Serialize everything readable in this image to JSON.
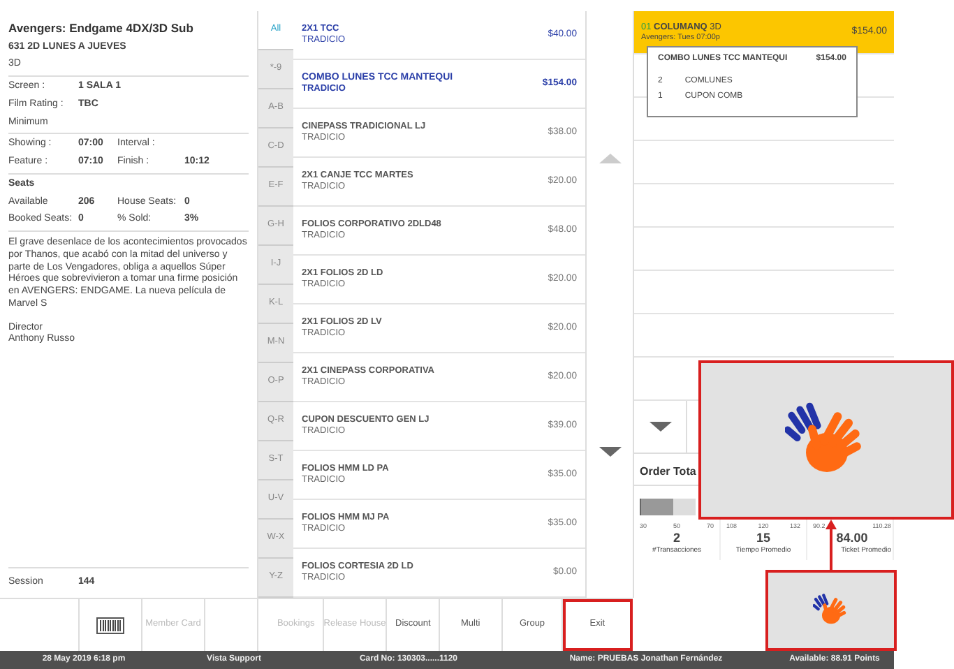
{
  "film": {
    "title": "Avengers: Endgame 4DX/3D Sub",
    "subtitle": "631 2D LUNES A JUEVES",
    "format": "3D",
    "details": [
      [
        "Screen :",
        "1  SALA 1"
      ],
      [
        "Film Rating :",
        "TBC"
      ]
    ],
    "rating_note": "Minimum",
    "times": [
      [
        "Showing :",
        "07:00",
        "Interval :"
      ],
      [
        "Feature :",
        "07:10",
        "Finish :",
        "10:12"
      ]
    ],
    "seats": {
      "heading": "Seats",
      "rows": [
        [
          "Available",
          "206",
          "House Seats:",
          "0"
        ],
        [
          "Booked Seats:",
          "0",
          "% Sold:",
          "3%"
        ]
      ]
    },
    "synopsis": "El grave desenlace de los acontecimientos provocados por Thanos, que acabó con la mitad del universo y parte de Los Vengadores, obliga a aquellos Súper Héroes que sobrevivieron a tomar una firme posición en AVENGERS: ENDGAME. La nueva película de Marvel S",
    "director": {
      "label": "Director",
      "name": "Anthony Russo"
    },
    "session": {
      "label": "Session",
      "value": "144"
    }
  },
  "alpha_tabs": [
    {
      "label": "All",
      "selected": true
    },
    {
      "label": "*-9",
      "selected": false
    },
    {
      "label": "A-B",
      "selected": false
    },
    {
      "label": "C-D",
      "selected": false
    },
    {
      "label": "E-F",
      "selected": false
    },
    {
      "label": "G-H",
      "selected": false
    },
    {
      "label": "I-J",
      "selected": false
    },
    {
      "label": "K-L",
      "selected": false
    },
    {
      "label": "M-N",
      "selected": false
    },
    {
      "label": "O-P",
      "selected": false
    },
    {
      "label": "Q-R",
      "selected": false
    },
    {
      "label": "S-T",
      "selected": false
    },
    {
      "label": "U-V",
      "selected": false
    },
    {
      "label": "W-X",
      "selected": false
    },
    {
      "label": "Y-Z",
      "selected": false
    }
  ],
  "items": [
    {
      "name": "2X1 TCC",
      "category": "TRADICIO",
      "price": "$40.00",
      "highlighted": true,
      "selected": false
    },
    {
      "name": "COMBO LUNES TCC MANTEQUI",
      "category": "TRADICIO",
      "price": "$154.00",
      "highlighted": true,
      "selected": true
    },
    {
      "name": "CINEPASS TRADICIONAL LJ",
      "category": "TRADICIO",
      "price": "$38.00",
      "highlighted": false,
      "selected": false
    },
    {
      "name": "2X1 CANJE TCC MARTES",
      "category": "TRADICIO",
      "price": "$20.00",
      "highlighted": false,
      "selected": false
    },
    {
      "name": "FOLIOS CORPORATIVO 2DLD48",
      "category": "TRADICIO",
      "price": "$48.00",
      "highlighted": false,
      "selected": false
    },
    {
      "name": "2X1 FOLIOS 2D LD",
      "category": "TRADICIO",
      "price": "$20.00",
      "highlighted": false,
      "selected": false
    },
    {
      "name": "2X1 FOLIOS 2D LV",
      "category": "TRADICIO",
      "price": "$20.00",
      "highlighted": false,
      "selected": false
    },
    {
      "name": "2X1 CINEPASS CORPORATIVA",
      "category": "TRADICIO",
      "price": "$20.00",
      "highlighted": false,
      "selected": false
    },
    {
      "name": "CUPON DESCUENTO GEN LJ",
      "category": "TRADICIO",
      "price": "$39.00",
      "highlighted": false,
      "selected": false
    },
    {
      "name": "FOLIOS HMM LD PA",
      "category": "TRADICIO",
      "price": "$35.00",
      "highlighted": false,
      "selected": false
    },
    {
      "name": "FOLIOS HMM MJ PA",
      "category": "TRADICIO",
      "price": "$35.00",
      "highlighted": false,
      "selected": false
    },
    {
      "name": "FOLIOS CORTESIA 2D LD",
      "category": "TRADICIO",
      "price": "$0.00",
      "highlighted": false,
      "selected": false
    }
  ],
  "order": {
    "lines": [
      {
        "number": "01",
        "title": "**COLUMANQ** 3D",
        "subtitle": "Avengers: Tues 07:00p",
        "price": "$154.00",
        "selected": true
      }
    ],
    "popup": {
      "title": "COMBO LUNES TCC MANTEQUI",
      "price": "$154.00",
      "components": [
        [
          "2",
          "COMLUNES"
        ],
        [
          "1",
          "CUPON COMB"
        ]
      ]
    },
    "total_label": "Order Tota",
    "gauges": [
      {
        "ticks": [
          "30",
          "50",
          "70"
        ],
        "value": "2",
        "label": "#Transacciones",
        "level": 0.6
      },
      {
        "ticks": [
          "108",
          "120",
          "132"
        ],
        "value": "15",
        "label": "Tiempo Promedio"
      },
      {
        "ticks": [
          "90.2",
          "110.28"
        ],
        "value": "84.00",
        "label": "Ticket Promedio"
      }
    ]
  },
  "left_buttons": [
    {
      "kind": "blank"
    },
    {
      "kind": "barcode"
    },
    {
      "kind": "text",
      "label": "Member Card",
      "disabled": true
    },
    {
      "kind": "blank"
    }
  ],
  "action_buttons": [
    {
      "label": "Bookings",
      "disabled": true,
      "highlighted": false
    },
    {
      "label": "Release House",
      "disabled": true,
      "highlighted": false
    },
    {
      "label": "Discount",
      "disabled": false,
      "highlighted": false
    },
    {
      "label": "Multi",
      "disabled": false,
      "highlighted": false
    },
    {
      "label": "Group",
      "disabled": false,
      "highlighted": false
    },
    {
      "label": "Exit",
      "disabled": false,
      "highlighted": true
    }
  ],
  "status_bar": [
    "28 May 2019 6:18 pm",
    "Vista Support",
    "Card No: 130303......1120",
    "Name: PRUEBAS Jonathan Fernández",
    "Available: 88.91 Points"
  ]
}
